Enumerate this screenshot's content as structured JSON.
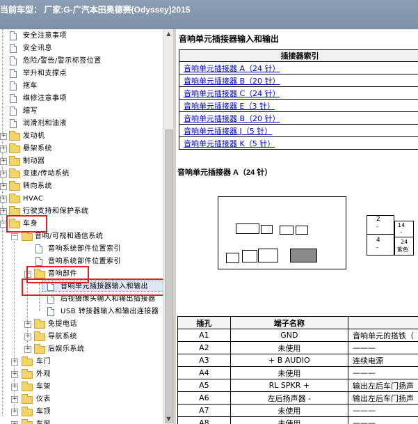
{
  "window": {
    "title": "当前车型：  厂家:G-广汽本田奥德赛(Odyssey)2015"
  },
  "tree": {
    "items": [
      {
        "label": "安全注意事项",
        "type": "doc"
      },
      {
        "label": "安全讯息",
        "type": "doc"
      },
      {
        "label": "危险/警告/警示标签位置",
        "type": "doc"
      },
      {
        "label": "举升和支撑点",
        "type": "doc"
      },
      {
        "label": "拖车",
        "type": "doc"
      },
      {
        "label": "维修注意事项",
        "type": "doc"
      },
      {
        "label": "缩写",
        "type": "doc"
      },
      {
        "label": "润滑剂和油液",
        "type": "doc"
      },
      {
        "label": "发动机",
        "type": "folder"
      },
      {
        "label": "悬架系统",
        "type": "folder"
      },
      {
        "label": "制动器",
        "type": "folder"
      },
      {
        "label": "变速/传动系统",
        "type": "folder"
      },
      {
        "label": "转向系统",
        "type": "folder"
      },
      {
        "label": "HVAC",
        "type": "folder"
      },
      {
        "label": "行驶支持和保护系统",
        "type": "folder"
      },
      {
        "label": "车身",
        "type": "folder"
      },
      {
        "label": "音响/可视和通信系统",
        "type": "folder"
      },
      {
        "label": "音响系统部件位置索引",
        "type": "doc"
      },
      {
        "label": "音响系统部件位置索引",
        "type": "doc"
      },
      {
        "label": "音响部件",
        "type": "folder"
      },
      {
        "label": "音响单元插接器输入和输出",
        "type": "doc"
      },
      {
        "label": "后视摄像头输入和输出插接器",
        "type": "doc"
      },
      {
        "label": "USB 转接器输入和输出连接器",
        "type": "doc"
      },
      {
        "label": "免提电话",
        "type": "folder"
      },
      {
        "label": "导航系统",
        "type": "folder"
      },
      {
        "label": "后娱乐系统",
        "type": "folder"
      },
      {
        "label": "车门",
        "type": "folder"
      },
      {
        "label": "外观",
        "type": "folder"
      },
      {
        "label": "车架",
        "type": "folder"
      },
      {
        "label": "仪表",
        "type": "folder"
      },
      {
        "label": "车顶",
        "type": "folder"
      },
      {
        "label": "车窗",
        "type": "folder"
      }
    ]
  },
  "content": {
    "title": "音响单元插接器输入和输出",
    "index_header": "插接器索引",
    "index_links": [
      "音响单元插接器 A（24 针）",
      "音响单元插接器 B（20 针）",
      "音响单元插接器 C（24 针）",
      "音响单元插接器 E（3 针）",
      "音响单元插接器 B（20 针）",
      "音响单元插接器 J（5 针）",
      "音响单元插接器 K（5 针）"
    ],
    "connector_title": "音响单元插接器 A（24 针）",
    "connector_grid": {
      "c1": "2",
      "c2": "-",
      "c3": "14",
      "c4": "-",
      "c5": "4",
      "c6": "-",
      "c7": "24",
      "c8": "紫色"
    },
    "pin_table": {
      "headers": [
        "插孔",
        "端子名称",
        ""
      ],
      "rows": [
        [
          "A1",
          "GND",
          "音响单元的搭铁（"
        ],
        [
          "A2",
          "未使用",
          "———"
        ],
        [
          "A3",
          "+ B AUDIO",
          "连续电源"
        ],
        [
          "A4",
          "未使用",
          "———"
        ],
        [
          "A5",
          "RL SPKR +",
          "输出左后车门扬声"
        ],
        [
          "A6",
          "左后扬声器 -",
          "输出左后车门扬声"
        ],
        [
          "A7",
          "未使用",
          "———"
        ],
        [
          "A8",
          "未使用",
          "———"
        ]
      ]
    }
  }
}
